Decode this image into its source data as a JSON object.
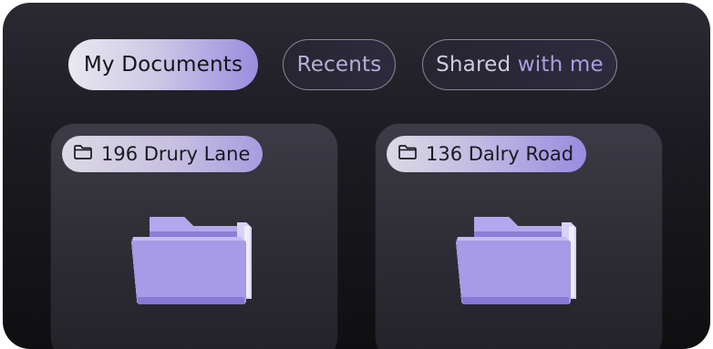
{
  "tabs": {
    "my_documents": "My Documents",
    "recents": "Recents",
    "shared_prefix": "Shared ",
    "shared_accent": "with me"
  },
  "cards": [
    {
      "title": "196 Drury Lane",
      "icon": "folder-icon"
    },
    {
      "title": "136 Dalry Road",
      "icon": "folder-icon"
    }
  ],
  "colors": {
    "accent": "#9b8cdf",
    "folder": "#a79ae6",
    "panel": "#1c1b21"
  }
}
